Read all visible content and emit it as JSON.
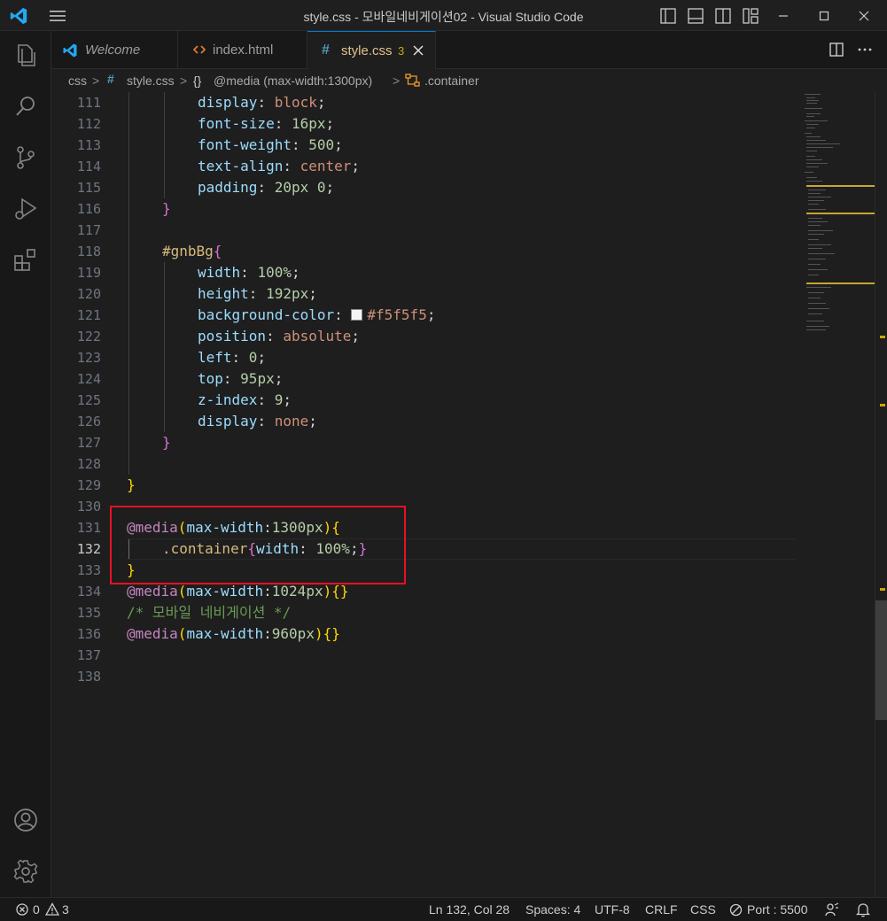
{
  "window": {
    "title": "style.css - 모바일네비게이션02 - Visual Studio Code"
  },
  "tabs": [
    {
      "label": "Welcome",
      "icon": "vscode-logo-icon"
    },
    {
      "label": "index.html",
      "icon": "html-file-icon"
    },
    {
      "label": "style.css",
      "icon": "css-file-icon",
      "badge": "3",
      "active": true
    }
  ],
  "breadcrumb": {
    "folder": "css",
    "file": "style.css",
    "media": "@media (max-width:1300px)",
    "selector": ".container",
    "separator": ">"
  },
  "editor": {
    "current_line": "132",
    "line_numbers": [
      "111",
      "112",
      "113",
      "114",
      "115",
      "116",
      "117",
      "118",
      "119",
      "120",
      "121",
      "122",
      "123",
      "124",
      "125",
      "126",
      "127",
      "128",
      "129",
      "130",
      "131",
      "132",
      "133",
      "134",
      "135",
      "136",
      "137",
      "138"
    ],
    "code": {
      "l111": {
        "prop": "display",
        "val": "block"
      },
      "l112": {
        "prop": "font-size",
        "num": "16px"
      },
      "l113": {
        "prop": "font-weight",
        "num": "500"
      },
      "l114": {
        "prop": "text-align",
        "val": "center"
      },
      "l115": {
        "prop": "padding",
        "num": "20px 0"
      },
      "l118": {
        "selector": "#gnbBg"
      },
      "l119": {
        "prop": "width",
        "num": "100%"
      },
      "l120": {
        "prop": "height",
        "num": "192px"
      },
      "l121": {
        "prop": "background-color",
        "val": "#f5f5f5"
      },
      "l122": {
        "prop": "position",
        "val": "absolute"
      },
      "l123": {
        "prop": "left",
        "num": "0"
      },
      "l124": {
        "prop": "top",
        "num": "95px"
      },
      "l125": {
        "prop": "z-index",
        "num": "9"
      },
      "l126": {
        "prop": "display",
        "val": "none"
      },
      "l131": {
        "at": "@media",
        "feature": "max-width",
        "num": "1300px"
      },
      "l132": {
        "selector": ".container",
        "prop": "width",
        "num": "100%"
      },
      "l134": {
        "at": "@media",
        "feature": "max-width",
        "num": "1024px"
      },
      "l135": {
        "comment": "/* 모바일 네비게이션 */"
      },
      "l136": {
        "at": "@media",
        "feature": "max-width",
        "num": "960px"
      }
    }
  },
  "statusbar": {
    "errors": "0",
    "warnings": "3",
    "position": "Ln 132, Col 28",
    "spaces": "Spaces: 4",
    "encoding": "UTF-8",
    "eol": "CRLF",
    "language": "CSS",
    "port": "Port : 5500"
  },
  "colors": {
    "accent": "#0078d4",
    "highlight_box": "#e81123",
    "tab_badge": "#cca700",
    "swatch": "#f5f5f5"
  }
}
